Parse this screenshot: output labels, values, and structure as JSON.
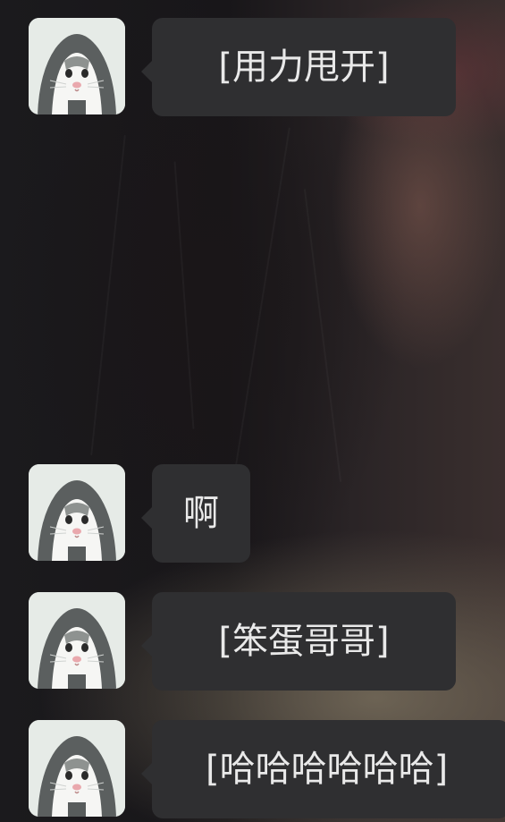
{
  "messages": [
    {
      "avatar": "hamster-in-hoodie-avatar",
      "text": "[用力甩开]"
    },
    {
      "avatar": "hamster-in-hoodie-avatar",
      "text": "啊"
    },
    {
      "avatar": "hamster-in-hoodie-avatar",
      "text": "[笨蛋哥哥]"
    },
    {
      "avatar": "hamster-in-hoodie-avatar",
      "text": "[哈哈哈哈哈哈]"
    }
  ],
  "colors": {
    "bubble": "#2f2f31",
    "bubble_text": "#e9e9e9"
  }
}
